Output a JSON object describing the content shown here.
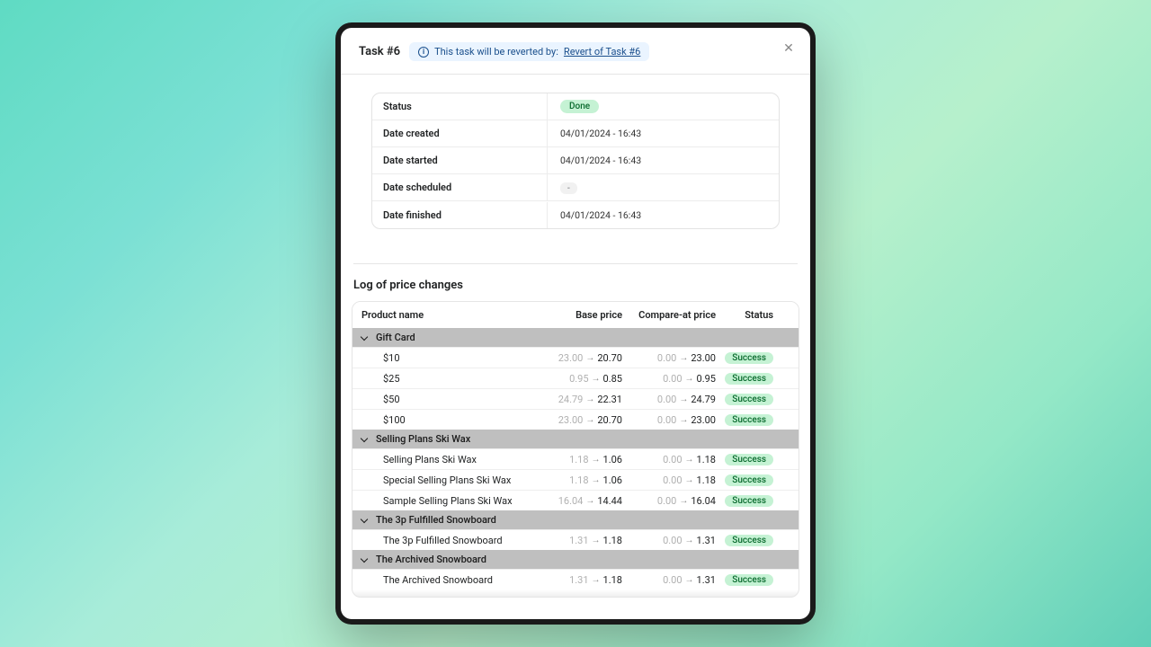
{
  "header": {
    "title": "Task #6",
    "info_prefix": "This task will be reverted by: ",
    "info_link": "Revert of Task #6"
  },
  "details": {
    "rows": [
      {
        "label": "Status",
        "type": "badge",
        "value": "Done"
      },
      {
        "label": "Date created",
        "type": "text",
        "value": "04/01/2024 - 16:43"
      },
      {
        "label": "Date started",
        "type": "text",
        "value": "04/01/2024 - 16:43"
      },
      {
        "label": "Date scheduled",
        "type": "empty",
        "value": "-"
      },
      {
        "label": "Date finished",
        "type": "text",
        "value": "04/01/2024 - 16:43"
      }
    ]
  },
  "log": {
    "title": "Log of price changes",
    "headers": {
      "name": "Product name",
      "base": "Base price",
      "compare": "Compare-at price",
      "status": "Status"
    },
    "success_label": "Success",
    "groups": [
      {
        "name": "Gift Card",
        "rows": [
          {
            "name": "$10",
            "base_old": "23.00",
            "base_new": "20.70",
            "comp_old": "0.00",
            "comp_new": "23.00"
          },
          {
            "name": "$25",
            "base_old": "0.95",
            "base_new": "0.85",
            "comp_old": "0.00",
            "comp_new": "0.95"
          },
          {
            "name": "$50",
            "base_old": "24.79",
            "base_new": "22.31",
            "comp_old": "0.00",
            "comp_new": "24.79"
          },
          {
            "name": "$100",
            "base_old": "23.00",
            "base_new": "20.70",
            "comp_old": "0.00",
            "comp_new": "23.00"
          }
        ]
      },
      {
        "name": "Selling Plans Ski Wax",
        "rows": [
          {
            "name": "Selling Plans Ski Wax",
            "base_old": "1.18",
            "base_new": "1.06",
            "comp_old": "0.00",
            "comp_new": "1.18"
          },
          {
            "name": "Special Selling Plans Ski Wax",
            "base_old": "1.18",
            "base_new": "1.06",
            "comp_old": "0.00",
            "comp_new": "1.18"
          },
          {
            "name": "Sample Selling Plans Ski Wax",
            "base_old": "16.04",
            "base_new": "14.44",
            "comp_old": "0.00",
            "comp_new": "16.04"
          }
        ]
      },
      {
        "name": "The 3p Fulfilled Snowboard",
        "rows": [
          {
            "name": "The 3p Fulfilled Snowboard",
            "base_old": "1.31",
            "base_new": "1.18",
            "comp_old": "0.00",
            "comp_new": "1.31"
          }
        ]
      },
      {
        "name": "The Archived Snowboard",
        "rows": [
          {
            "name": "The Archived Snowboard",
            "base_old": "1.31",
            "base_new": "1.18",
            "comp_old": "0.00",
            "comp_new": "1.31"
          }
        ]
      }
    ]
  }
}
